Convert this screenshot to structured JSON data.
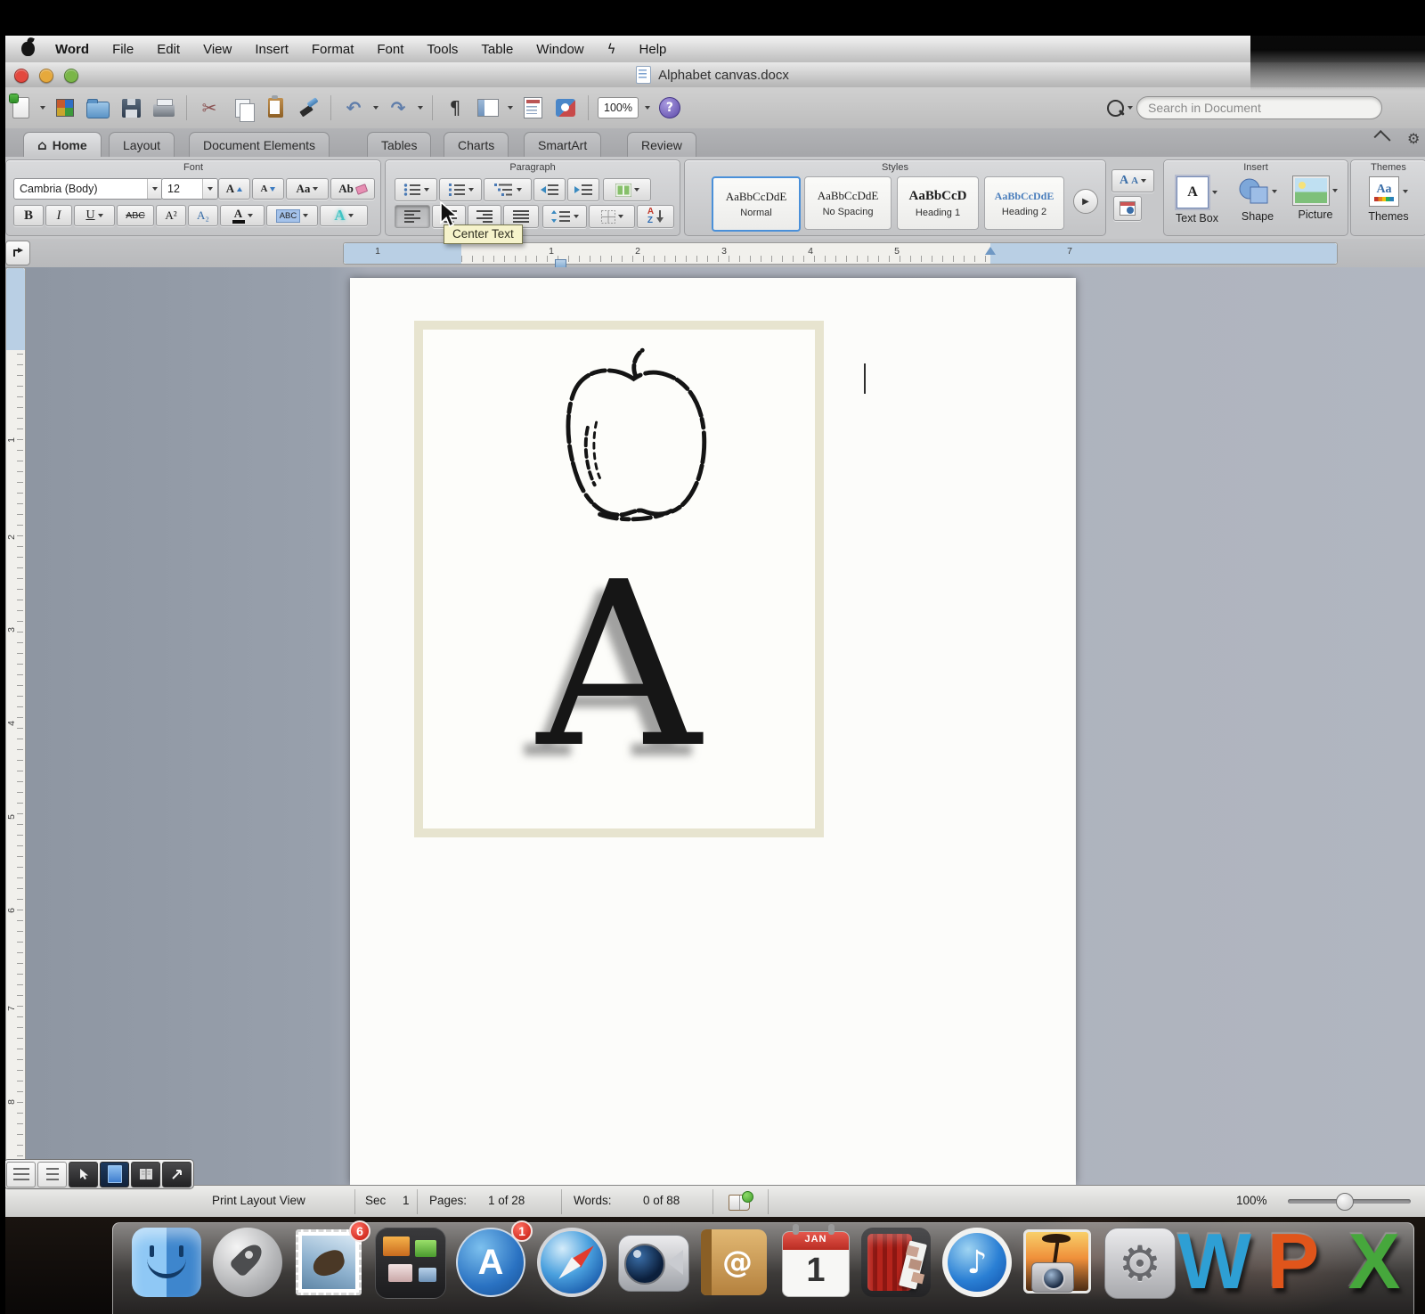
{
  "menu_bar": {
    "items": [
      "Word",
      "File",
      "Edit",
      "View",
      "Insert",
      "Format",
      "Font",
      "Tools",
      "Table",
      "Window"
    ],
    "script_glyph": "ϟ",
    "help": "Help"
  },
  "title_bar": {
    "title": "Alphabet canvas.docx"
  },
  "toolbar": {
    "zoom_value": "100%",
    "search_placeholder": "Search in Document",
    "glyphs": {
      "cut": "✂",
      "undo": "↶",
      "redo": "↷",
      "pilcrow": "¶",
      "help": "?"
    }
  },
  "ribbon": {
    "home_glyph": "⌂",
    "tabs": [
      "Home",
      "Layout",
      "Document Elements",
      "Tables",
      "Charts",
      "SmartArt",
      "Review"
    ],
    "active_tab": "Home",
    "font_group": {
      "label": "Font",
      "font_name": "Cambria (Body)",
      "font_size": "12",
      "glyphs": {
        "grow": "A",
        "shrink": "A",
        "case": "Aa",
        "clear": "Ab",
        "bold": "B",
        "italic": "I",
        "underline": "U",
        "strike": "ABC",
        "superscript": "A²",
        "subscript": "A₂",
        "color": "A",
        "highlight": "ABC",
        "effects": "A"
      }
    },
    "paragraph_group": {
      "label": "Paragraph",
      "sort_a": "A",
      "sort_z": "Z"
    },
    "styles_group": {
      "label": "Styles",
      "items": [
        {
          "sample": "AaBbCcDdE",
          "name": "Normal"
        },
        {
          "sample": "AaBbCcDdE",
          "name": "No Spacing"
        },
        {
          "sample": "AaBbCcD",
          "name": "Heading 1"
        },
        {
          "sample": "AaBbCcDdE",
          "name": "Heading 2"
        }
      ],
      "overflow_glyph": "▶"
    },
    "insert_group": {
      "label": "Insert",
      "buttons": [
        "Text Box",
        "Shape",
        "Picture"
      ],
      "textbox_glyph": "A"
    },
    "themes_group": {
      "label": "Themes",
      "button_label": "Themes",
      "themes_glyph": "Aa"
    }
  },
  "tooltip": {
    "text": "Center Text"
  },
  "ruler": {
    "margin_number": "1",
    "h_numbers": [
      "1",
      "2",
      "3",
      "4",
      "5"
    ],
    "right_number": "7",
    "v_numbers": [
      "1",
      "2",
      "3",
      "4",
      "5",
      "6",
      "7",
      "8"
    ]
  },
  "page": {
    "letter": "A"
  },
  "status_bar": {
    "view_label": "Print Layout View",
    "sec_label": "Sec",
    "sec_value": "1",
    "pages_label": "Pages:",
    "pages_value": "1 of 28",
    "words_label": "Words:",
    "words_value": "0 of 88",
    "zoom_value": "100%"
  },
  "dock": {
    "mail_badge": "6",
    "appstore_badge": "1",
    "appstore_glyph": "A",
    "itunes_glyph": "♪",
    "addressbook_glyph": "@",
    "ical_month": "JAN",
    "ical_day": "1",
    "prefs_glyph": "⚙",
    "word_glyph": "W",
    "powerpoint_glyph": "P",
    "excel_glyph": "X"
  },
  "colors": {
    "selection_blue": "#4a90d9",
    "word_blue": "#2e9fd4",
    "powerpoint_orange": "#e0551b",
    "excel_green": "#46a73c",
    "badge_red": "#c3170c"
  }
}
